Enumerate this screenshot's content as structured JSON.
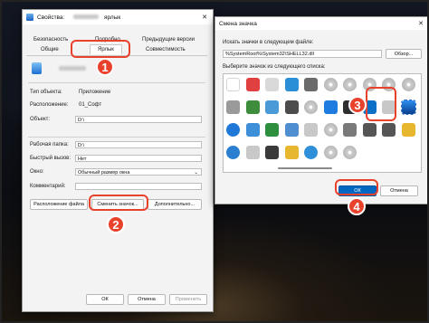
{
  "properties_window": {
    "title": "Свойства:",
    "title_suffix": "ярлык",
    "tabs": {
      "row1": [
        "Безопасность",
        "Подробно",
        "Предыдущие версии"
      ],
      "row2": [
        "Общие",
        "Ярлык",
        "Совместимость"
      ],
      "active": "Ярлык"
    },
    "fields": {
      "type_label": "Тип объекта:",
      "type_value": "Приложение",
      "location_label": "Расположение:",
      "location_value": "01_Софт",
      "object_label": "Объект:",
      "object_value": "D:\\",
      "workdir_label": "Рабочая папка:",
      "workdir_value": "D:\\",
      "hotkey_label": "Быстрый вызов:",
      "hotkey_value": "Нет",
      "window_label": "Окно:",
      "window_value": "Обычный размер окна",
      "comment_label": "Комментарий:"
    },
    "buttons": {
      "open_location": "Расположение файла",
      "change_icon": "Сменить значок...",
      "advanced": "Дополнительно...",
      "ok": "ОК",
      "cancel": "Отмена",
      "apply": "Применить"
    }
  },
  "icon_dialog": {
    "title": "Смена значка",
    "search_label": "Искать значки в следующем файле:",
    "path_value": "%SystemRoot%\\System32\\SHELL32.dll",
    "browse": "Обзор...",
    "select_label": "Выберите значок из следующего списка:",
    "ok": "ОК",
    "cancel": "Отмена",
    "icons": [
      {
        "name": "blank-icon",
        "color": "#ffffff"
      },
      {
        "name": "doc-error-icon",
        "color": "#e04040"
      },
      {
        "name": "card-icon",
        "color": "#d9d9d9"
      },
      {
        "name": "monitor-globe-icon",
        "color": "#2a8fd6"
      },
      {
        "name": "disk-icon",
        "color": "#6b6b6b"
      },
      {
        "name": "disc-icon",
        "color": "#cfcfcf"
      },
      {
        "name": "disc-icon",
        "color": "#cfcfcf"
      },
      {
        "name": "disc-icon",
        "color": "#cfcfcf"
      },
      {
        "name": "disc-icon",
        "color": "#cfcfcf"
      },
      {
        "name": "disc-icon",
        "color": "#cfcfcf"
      },
      {
        "name": "drive-icon",
        "color": "#9a9a9a"
      },
      {
        "name": "chip-icon",
        "color": "#3d8d3d"
      },
      {
        "name": "network-icon",
        "color": "#4a9ad8"
      },
      {
        "name": "keyboard-icon",
        "color": "#4c4c4c"
      },
      {
        "name": "cd-icon",
        "color": "#d0d0d0"
      },
      {
        "name": "arrow-right-icon",
        "color": "#1e7be0"
      },
      {
        "name": "usb-drive-icon",
        "color": "#2f2f2f"
      },
      {
        "name": "lock-icon",
        "color": "#0a70c8"
      },
      {
        "name": "printer-icon",
        "color": "#c8c8c8"
      },
      {
        "name": "phone-device-icon",
        "color": "#1b5fb0"
      },
      {
        "name": "help-icon",
        "color": "#1f78d8"
      },
      {
        "name": "display-icon",
        "color": "#3c8fd8"
      },
      {
        "name": "check-icon",
        "color": "#2e8f3e"
      },
      {
        "name": "users-icon",
        "color": "#4f8ed0"
      },
      {
        "name": "printer-icon",
        "color": "#c8c8c8"
      },
      {
        "name": "cd-icon",
        "color": "#d0d0d0"
      },
      {
        "name": "drive-icon",
        "color": "#7a7a7a"
      },
      {
        "name": "drive-icon",
        "color": "#555555"
      },
      {
        "name": "drive-icon",
        "color": "#555555"
      },
      {
        "name": "folder-icon",
        "color": "#e7b730"
      },
      {
        "name": "info-icon",
        "color": "#2a7fd0"
      },
      {
        "name": "printer-icon",
        "color": "#c8c8c8"
      },
      {
        "name": "pc-icon",
        "color": "#3a3a3a"
      },
      {
        "name": "folder-icon",
        "color": "#e7b730"
      },
      {
        "name": "globe-icon",
        "color": "#2f8fd8"
      },
      {
        "name": "cd-icon",
        "color": "#d0d0d0"
      },
      {
        "name": "cd-icon",
        "color": "#d0d0d0"
      }
    ]
  },
  "callouts": {
    "one": "1",
    "two": "2",
    "three": "3",
    "four": "4"
  },
  "colors": {
    "accent": "#0067c0",
    "callout": "#e8412c"
  }
}
